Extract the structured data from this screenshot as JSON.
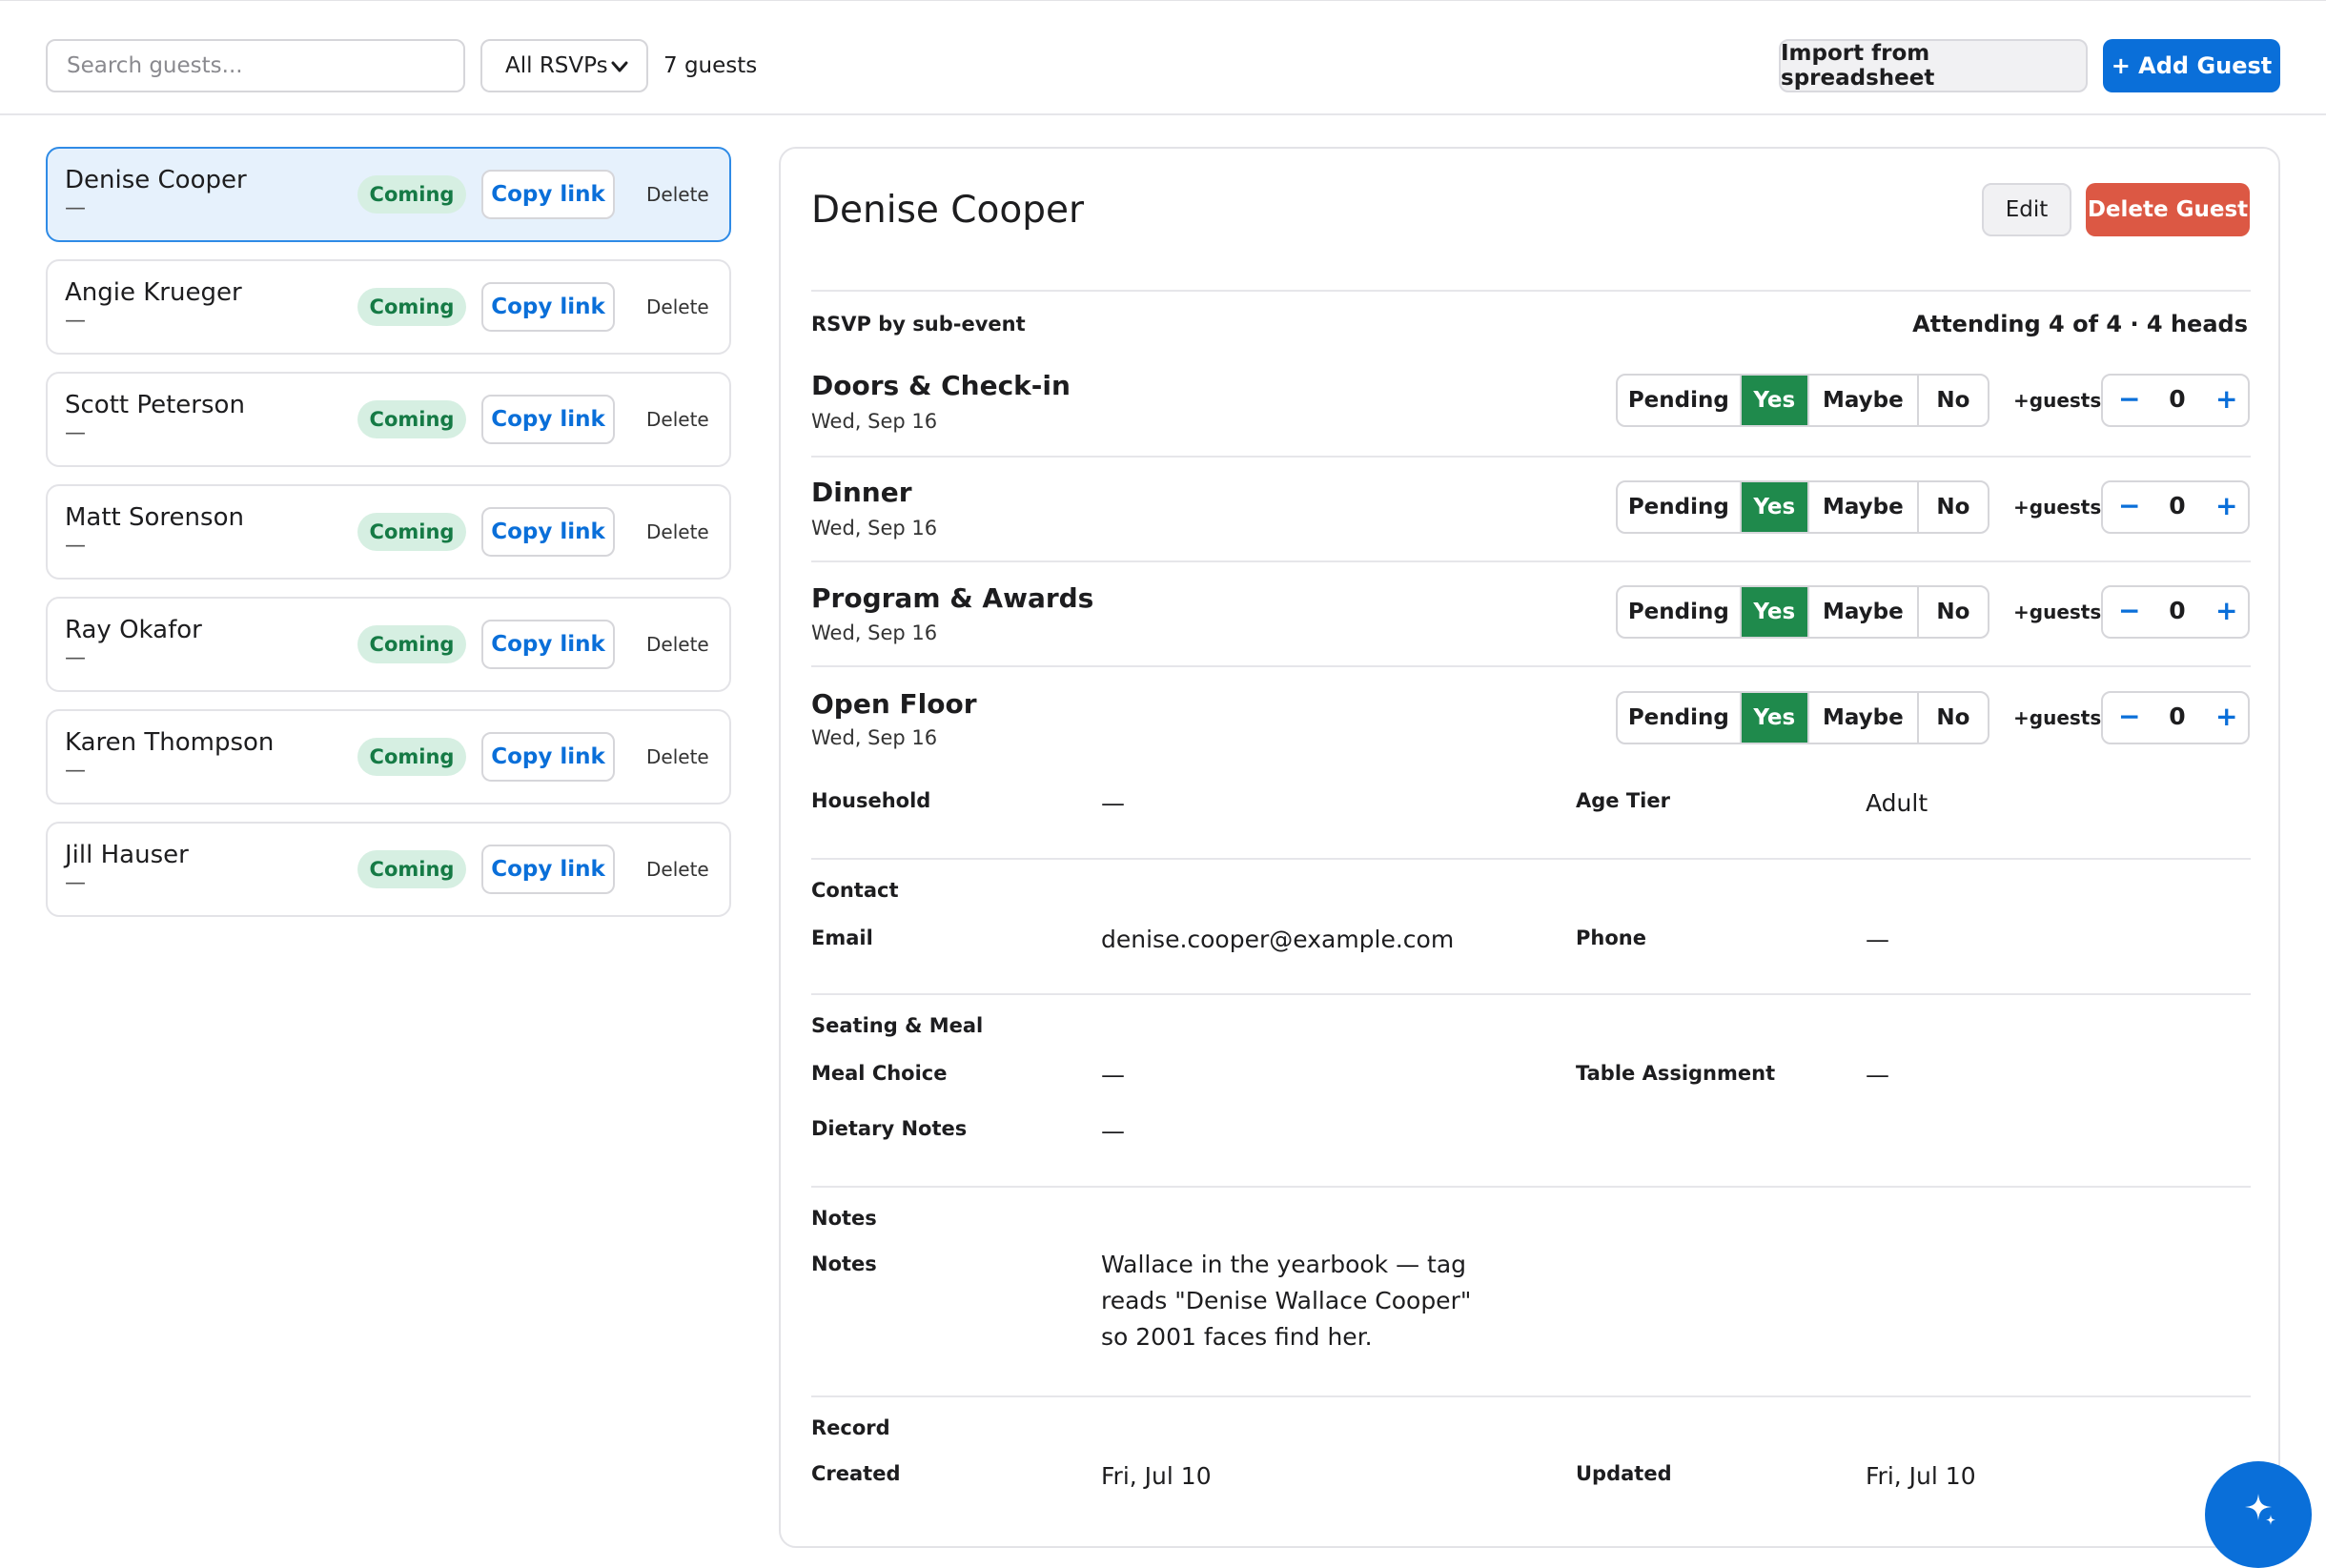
{
  "toolbar": {
    "search_placeholder": "Search guests...",
    "filter_selected": "All RSVPs",
    "guest_count": "7 guests",
    "import_label": "Import from spreadsheet",
    "add_label": "+ Add Guest"
  },
  "guests": [
    {
      "name": "Denise Cooper",
      "sub": "—",
      "status": "Coming",
      "copy": "Copy link",
      "delete": "Delete"
    },
    {
      "name": "Angie Krueger",
      "sub": "—",
      "status": "Coming",
      "copy": "Copy link",
      "delete": "Delete"
    },
    {
      "name": "Scott Peterson",
      "sub": "—",
      "status": "Coming",
      "copy": "Copy link",
      "delete": "Delete"
    },
    {
      "name": "Matt Sorenson",
      "sub": "—",
      "status": "Coming",
      "copy": "Copy link",
      "delete": "Delete"
    },
    {
      "name": "Ray Okafor",
      "sub": "—",
      "status": "Coming",
      "copy": "Copy link",
      "delete": "Delete"
    },
    {
      "name": "Karen Thompson",
      "sub": "—",
      "status": "Coming",
      "copy": "Copy link",
      "delete": "Delete"
    },
    {
      "name": "Jill Hauser",
      "sub": "—",
      "status": "Coming",
      "copy": "Copy link",
      "delete": "Delete"
    }
  ],
  "detail": {
    "title": "Denise Cooper",
    "edit_label": "Edit",
    "delete_label": "Delete Guest",
    "rsvp_heading": "RSVP by sub-event",
    "attending": "Attending 4 of 4 · 4 heads",
    "rsvp_options": [
      "Pending",
      "Yes",
      "Maybe",
      "No"
    ],
    "plus_guests_label": "+guests",
    "minus": "−",
    "plus": "+",
    "events": [
      {
        "name": "Doors & Check-in",
        "date": "Wed, Sep 16",
        "selected": "Yes",
        "extra": "0"
      },
      {
        "name": "Dinner",
        "date": "Wed, Sep 16",
        "selected": "Yes",
        "extra": "0"
      },
      {
        "name": "Program & Awards",
        "date": "Wed, Sep 16",
        "selected": "Yes",
        "extra": "0"
      },
      {
        "name": "Open Floor",
        "date": "Wed, Sep 16",
        "selected": "Yes",
        "extra": "0"
      }
    ],
    "household_label": "Household",
    "household_value": "—",
    "age_tier_label": "Age Tier",
    "age_tier_value": "Adult",
    "contact_heading": "Contact",
    "email_label": "Email",
    "email_value": "denise.cooper@example.com",
    "phone_label": "Phone",
    "phone_value": "—",
    "seating_heading": "Seating & Meal",
    "meal_label": "Meal Choice",
    "meal_value": "—",
    "table_label": "Table Assignment",
    "table_value": "—",
    "dietary_label": "Dietary Notes",
    "dietary_value": "—",
    "notes_heading": "Notes",
    "notes_label": "Notes",
    "notes_value": "Wallace in the yearbook — tag reads \"Denise Wallace Cooper\" so 2001 faces find her.",
    "record_heading": "Record",
    "created_label": "Created",
    "created_value": "Fri, Jul 10",
    "updated_label": "Updated",
    "updated_value": "Fri, Jul 10"
  },
  "colors": {
    "accent": "#0a6fd9",
    "success": "#1f8a4c",
    "danger": "#dc5844",
    "badge_bg": "#d6efe2"
  },
  "icons": {
    "fab": "sparkle-icon",
    "select": "chevron-down-icon"
  }
}
